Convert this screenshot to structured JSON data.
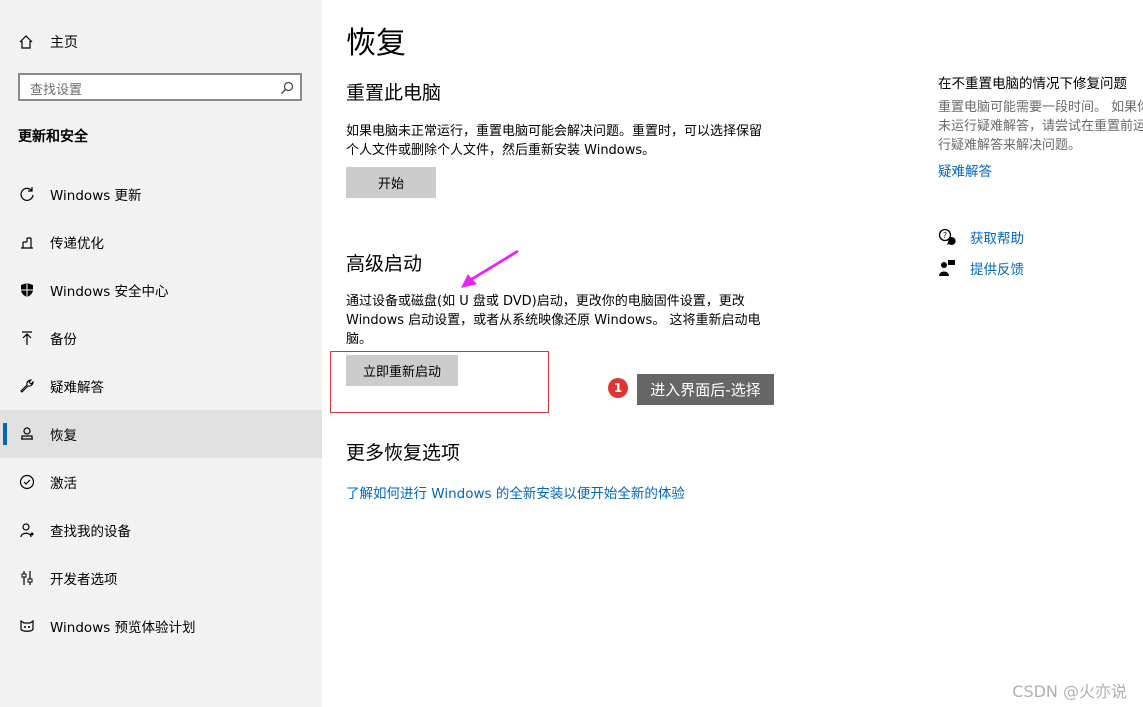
{
  "sidebar": {
    "home_label": "主页",
    "search_placeholder": "查找设置",
    "section_title": "更新和安全",
    "items": [
      {
        "label": "Windows 更新",
        "icon": "sync-icon"
      },
      {
        "label": "传递优化",
        "icon": "delivery-optimization-icon"
      },
      {
        "label": "Windows 安全中心",
        "icon": "shield-icon"
      },
      {
        "label": "备份",
        "icon": "upload-arrow-icon"
      },
      {
        "label": "疑难解答",
        "icon": "wrench-icon"
      },
      {
        "label": "恢复",
        "icon": "recovery-icon",
        "active": true
      },
      {
        "label": "激活",
        "icon": "check-circle-icon"
      },
      {
        "label": "查找我的设备",
        "icon": "person-location-icon"
      },
      {
        "label": "开发者选项",
        "icon": "developer-sliders-icon"
      },
      {
        "label": "Windows 预览体验计划",
        "icon": "insider-cat-icon"
      }
    ]
  },
  "main": {
    "title": "恢复",
    "reset": {
      "heading": "重置此电脑",
      "desc_line1": "如果电脑未正常运行，重置电脑可能会解决问题。重置时，可以选择保留",
      "desc_line2": "个人文件或删除个人文件，然后重新安装 Windows。",
      "button": "开始"
    },
    "advanced": {
      "heading": "高级启动",
      "desc_line1": "通过设备或磁盘(如 U 盘或 DVD)启动，更改你的电脑固件设置，更改",
      "desc_line2": "Windows 启动设置，或者从系统映像还原 Windows。 这将重新启动电",
      "desc_line3": "脑。",
      "button": "立即重新启动"
    },
    "more": {
      "heading": "更多恢复选项",
      "link": "了解如何进行 Windows 的全新安装以便开始全新的体验"
    }
  },
  "annotation": {
    "badge": "1",
    "callout": "进入界面后-选择"
  },
  "right_panel": {
    "title": "在不重置电脑的情况下修复问题",
    "desc_line1": "重置电脑可能需要一段时间。 如果你",
    "desc_line2": "未运行疑难解答，请尝试在重置前运",
    "desc_line3": "行疑难解答来解决问题。",
    "troubleshoot_link": "疑难解答",
    "get_help": "获取帮助",
    "feedback": "提供反馈"
  },
  "watermark": "CSDN @火亦说",
  "colors": {
    "accent": "#0067c0",
    "sidebar_bg": "#f2f2f2",
    "button_bg": "#cccccc",
    "annotation_red": "#e03434",
    "annotation_arrow": "#ee22ee"
  }
}
